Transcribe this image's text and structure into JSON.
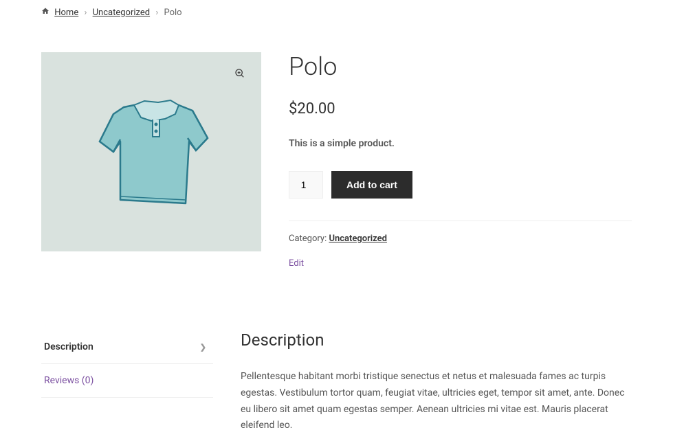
{
  "breadcrumb": {
    "home": "Home",
    "category": "Uncategorized",
    "current": "Polo"
  },
  "product": {
    "title": "Polo",
    "currency": "$",
    "price": "20.00",
    "short_description": "This is a simple product.",
    "quantity": "1",
    "add_to_cart": "Add to cart",
    "category_label": "Category: ",
    "category_link": "Uncategorized",
    "edit": "Edit"
  },
  "tabs": {
    "description_label": "Description",
    "reviews_label": "Reviews (0)"
  },
  "description": {
    "heading": "Description",
    "body": "Pellentesque habitant morbi tristique senectus et netus et malesuada fames ac turpis egestas. Vestibulum tortor quam, feugiat vitae, ultricies eget, tempor sit amet, ante. Donec eu libero sit amet quam egestas semper. Aenean ultricies mi vitae est. Mauris placerat eleifend leo."
  }
}
